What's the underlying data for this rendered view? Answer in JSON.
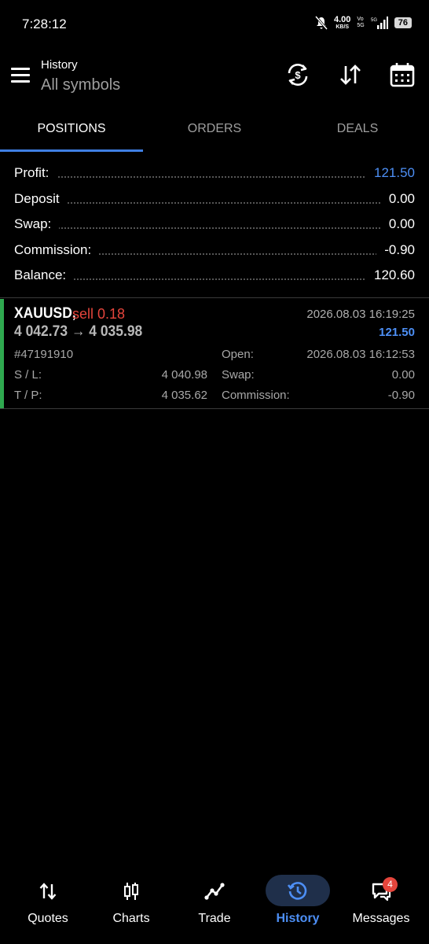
{
  "status_bar": {
    "time": "7:28:12",
    "net_speed_value": "4.00",
    "net_speed_unit": "KB/S",
    "volte_top": "Vo",
    "volte_bottom": "5G",
    "network": "5G",
    "battery": "76"
  },
  "header": {
    "title": "History",
    "subtitle": "All symbols"
  },
  "tabs": [
    {
      "label": "POSITIONS",
      "active": true
    },
    {
      "label": "ORDERS",
      "active": false
    },
    {
      "label": "DEALS",
      "active": false
    }
  ],
  "summary": [
    {
      "label": "Profit:",
      "value": "121.50"
    },
    {
      "label": "Deposit",
      "value": "0.00"
    },
    {
      "label": "Swap:",
      "value": "0.00"
    },
    {
      "label": "Commission:",
      "value": "-0.90"
    },
    {
      "label": "Balance:",
      "value": "120.60"
    }
  ],
  "position": {
    "symbol": "XAUUSD,",
    "side": "sell 0.18",
    "prices": "4 042.73 → 4 035.98",
    "close_time": "2026.08.03 16:19:25",
    "profit": "121.50",
    "ticket": "#47191910",
    "open_label": "Open:",
    "open_time": "2026.08.03 16:12:53",
    "sl_label": "S / L:",
    "sl_value": "4 040.98",
    "swap_label": "Swap:",
    "swap_value": "0.00",
    "tp_label": "T / P:",
    "tp_value": "4 035.62",
    "commission_label": "Commission:",
    "commission_value": "-0.90"
  },
  "bottom_nav": [
    {
      "label": "Quotes",
      "icon": "quotes-arrows-icon"
    },
    {
      "label": "Charts",
      "icon": "candlestick-icon"
    },
    {
      "label": "Trade",
      "icon": "trade-line-icon"
    },
    {
      "label": "History",
      "icon": "history-clock-icon",
      "active": true
    },
    {
      "label": "Messages",
      "icon": "messages-icon",
      "badge": "4"
    }
  ],
  "colors": {
    "accent": "#4d8ff5",
    "sell": "#e5453c",
    "profit_bar": "#2fa84f",
    "background": "#000000"
  }
}
